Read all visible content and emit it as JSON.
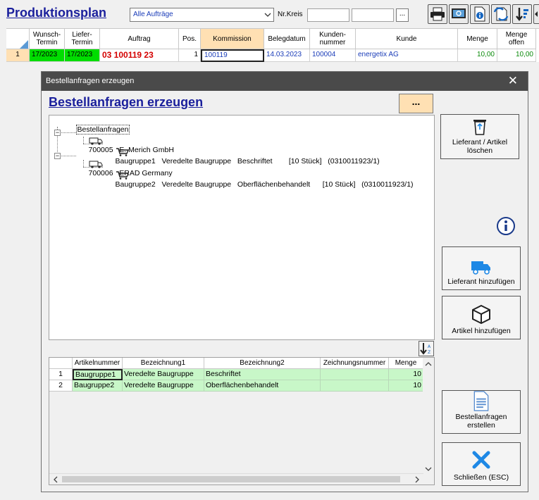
{
  "app": {
    "title": "Produktionsplan",
    "filter_value": "Alle Aufträge",
    "nrkreis_label": "Nr.Kreis",
    "dots_label": "..."
  },
  "grid": {
    "headers": [
      "",
      "Wunsch-\nTermin",
      "Liefer-\nTermin",
      "Auftrag",
      "Pos.",
      "Kommission",
      "Belegdatum",
      "Kunden-\nnummer",
      "Kunde",
      "Menge",
      "Menge\noffen"
    ],
    "row": {
      "num": "1",
      "wunsch": "17/2023",
      "liefer": "17/2023",
      "auftrag": "03 100119 23",
      "pos": "1",
      "kommission": "100119",
      "belegdatum": "14.03.2023",
      "kundennummer": "100004",
      "kunde": "energetix AG",
      "menge": "10,00",
      "offen": "10,00"
    }
  },
  "dialog": {
    "window_title": "Bestellanfragen erzeugen",
    "heading": "Bestellanfragen erzeugen",
    "dots_label": "...",
    "tree": {
      "root": "Bestellanfragen",
      "suppliers": [
        {
          "label": "700005   E. Merich GmbH",
          "item": "Baugruppe1   Veredelte Baugruppe   Beschriftet        [10 Stück]   (0310011923/1)"
        },
        {
          "label": "700006   ERAD Germany",
          "item": "Baugruppe2   Veredelte Baugruppe   Oberflächenbehandelt      [10 Stück]   (0310011923/1)"
        }
      ]
    },
    "buttons": {
      "delete": "Lieferant / Artikel löschen",
      "add_supplier": "Lieferant hinzufügen",
      "add_article": "Artikel hinzufügen",
      "create": "Bestellanfragen erstellen",
      "close": "Schließen (ESC)"
    },
    "table": {
      "headers": [
        "",
        "Artikelnummer",
        "Bezeichnung1",
        "Bezeichnung2",
        "Zeichnungsnummer",
        "Menge"
      ],
      "rows": [
        [
          "1",
          "Baugruppe1",
          "Veredelte Baugruppe",
          "Beschriftet",
          "",
          "10"
        ],
        [
          "2",
          "Baugruppe2",
          "Veredelte Baugruppe",
          "Oberflächenbehandelt",
          "",
          "10"
        ]
      ]
    }
  },
  "colors": {
    "accent_title": "#1a1f9c",
    "selected_header": "#ffe0b3",
    "green_cell": "#00dd00",
    "order_red": "#d40000",
    "row_green": "#c8f7c8"
  }
}
